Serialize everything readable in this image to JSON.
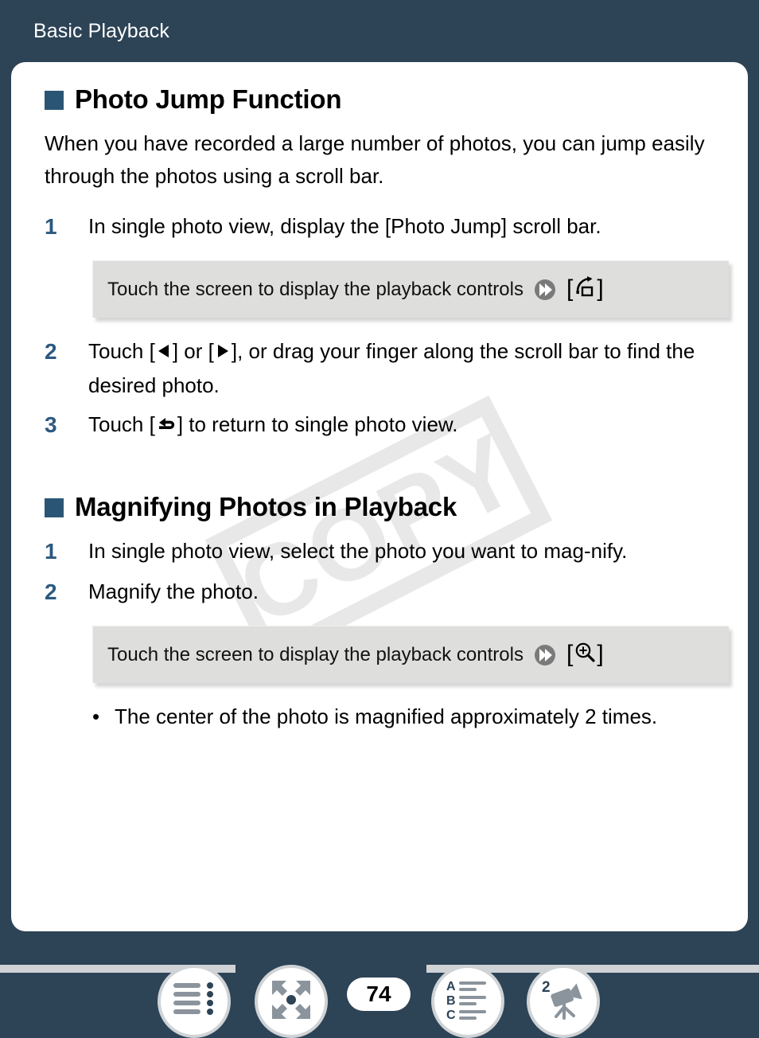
{
  "header": {
    "title": "Basic Playback"
  },
  "sections": [
    {
      "heading": "Photo Jump Function",
      "intro": "When you have recorded a large number of photos, you can jump easily through the photos using a scroll bar.",
      "steps": [
        {
          "num": "1",
          "text": "In single photo view, display the [Photo Jump] scroll bar."
        },
        {
          "num": "2",
          "text_before": "Touch [",
          "glyph1": "left-triangle",
          "text_mid": "] or [",
          "glyph2": "right-triangle",
          "text_after": "], or drag your finger along the scroll bar to find the desired photo."
        },
        {
          "num": "3",
          "text_before": "Touch [",
          "glyph1": "return-arrow",
          "text_after": "] to return to single photo view."
        }
      ],
      "gray_box": {
        "text": "Touch the screen to display the playback controls",
        "arrow_icon": "double-chevron-circle-icon",
        "bracket_open": "[",
        "bracket_close": "]",
        "action_icon": "photo-jump-icon"
      }
    },
    {
      "heading": "Magnifying Photos in Playback",
      "steps": [
        {
          "num": "1",
          "text": "In single photo view, select the photo you want to mag-nify."
        },
        {
          "num": "2",
          "text": "Magnify the photo."
        }
      ],
      "gray_box": {
        "text": "Touch the screen to display the playback controls",
        "arrow_icon": "double-chevron-circle-icon",
        "bracket_open": "[",
        "bracket_close": "]",
        "action_icon": "magnify-plus-icon"
      },
      "bullets": [
        {
          "marker": "•",
          "text": "The center of the photo is magnified approximately 2 times."
        }
      ]
    }
  ],
  "watermark": {
    "text": "COPY"
  },
  "bottom_nav": {
    "page_number": "74",
    "buttons": [
      {
        "name": "table-of-contents-button",
        "icon": "list-lines-icon"
      },
      {
        "name": "quick-reference-button",
        "icon": "four-arrows-expand-icon"
      },
      {
        "name": "alphabetical-index-button",
        "icon": "abc-index-icon"
      },
      {
        "name": "camcorder-button",
        "icon": "camcorder-2-icon",
        "badge": "2"
      }
    ]
  },
  "colors": {
    "page_background": "#2d4356",
    "card_background": "#ffffff",
    "accent_blue": "#2b5575",
    "step_number_blue": "#2b5980",
    "gray_box": "#dededd",
    "nav_rail": "#cfd3d6",
    "watermark": "#e8e8e8"
  }
}
